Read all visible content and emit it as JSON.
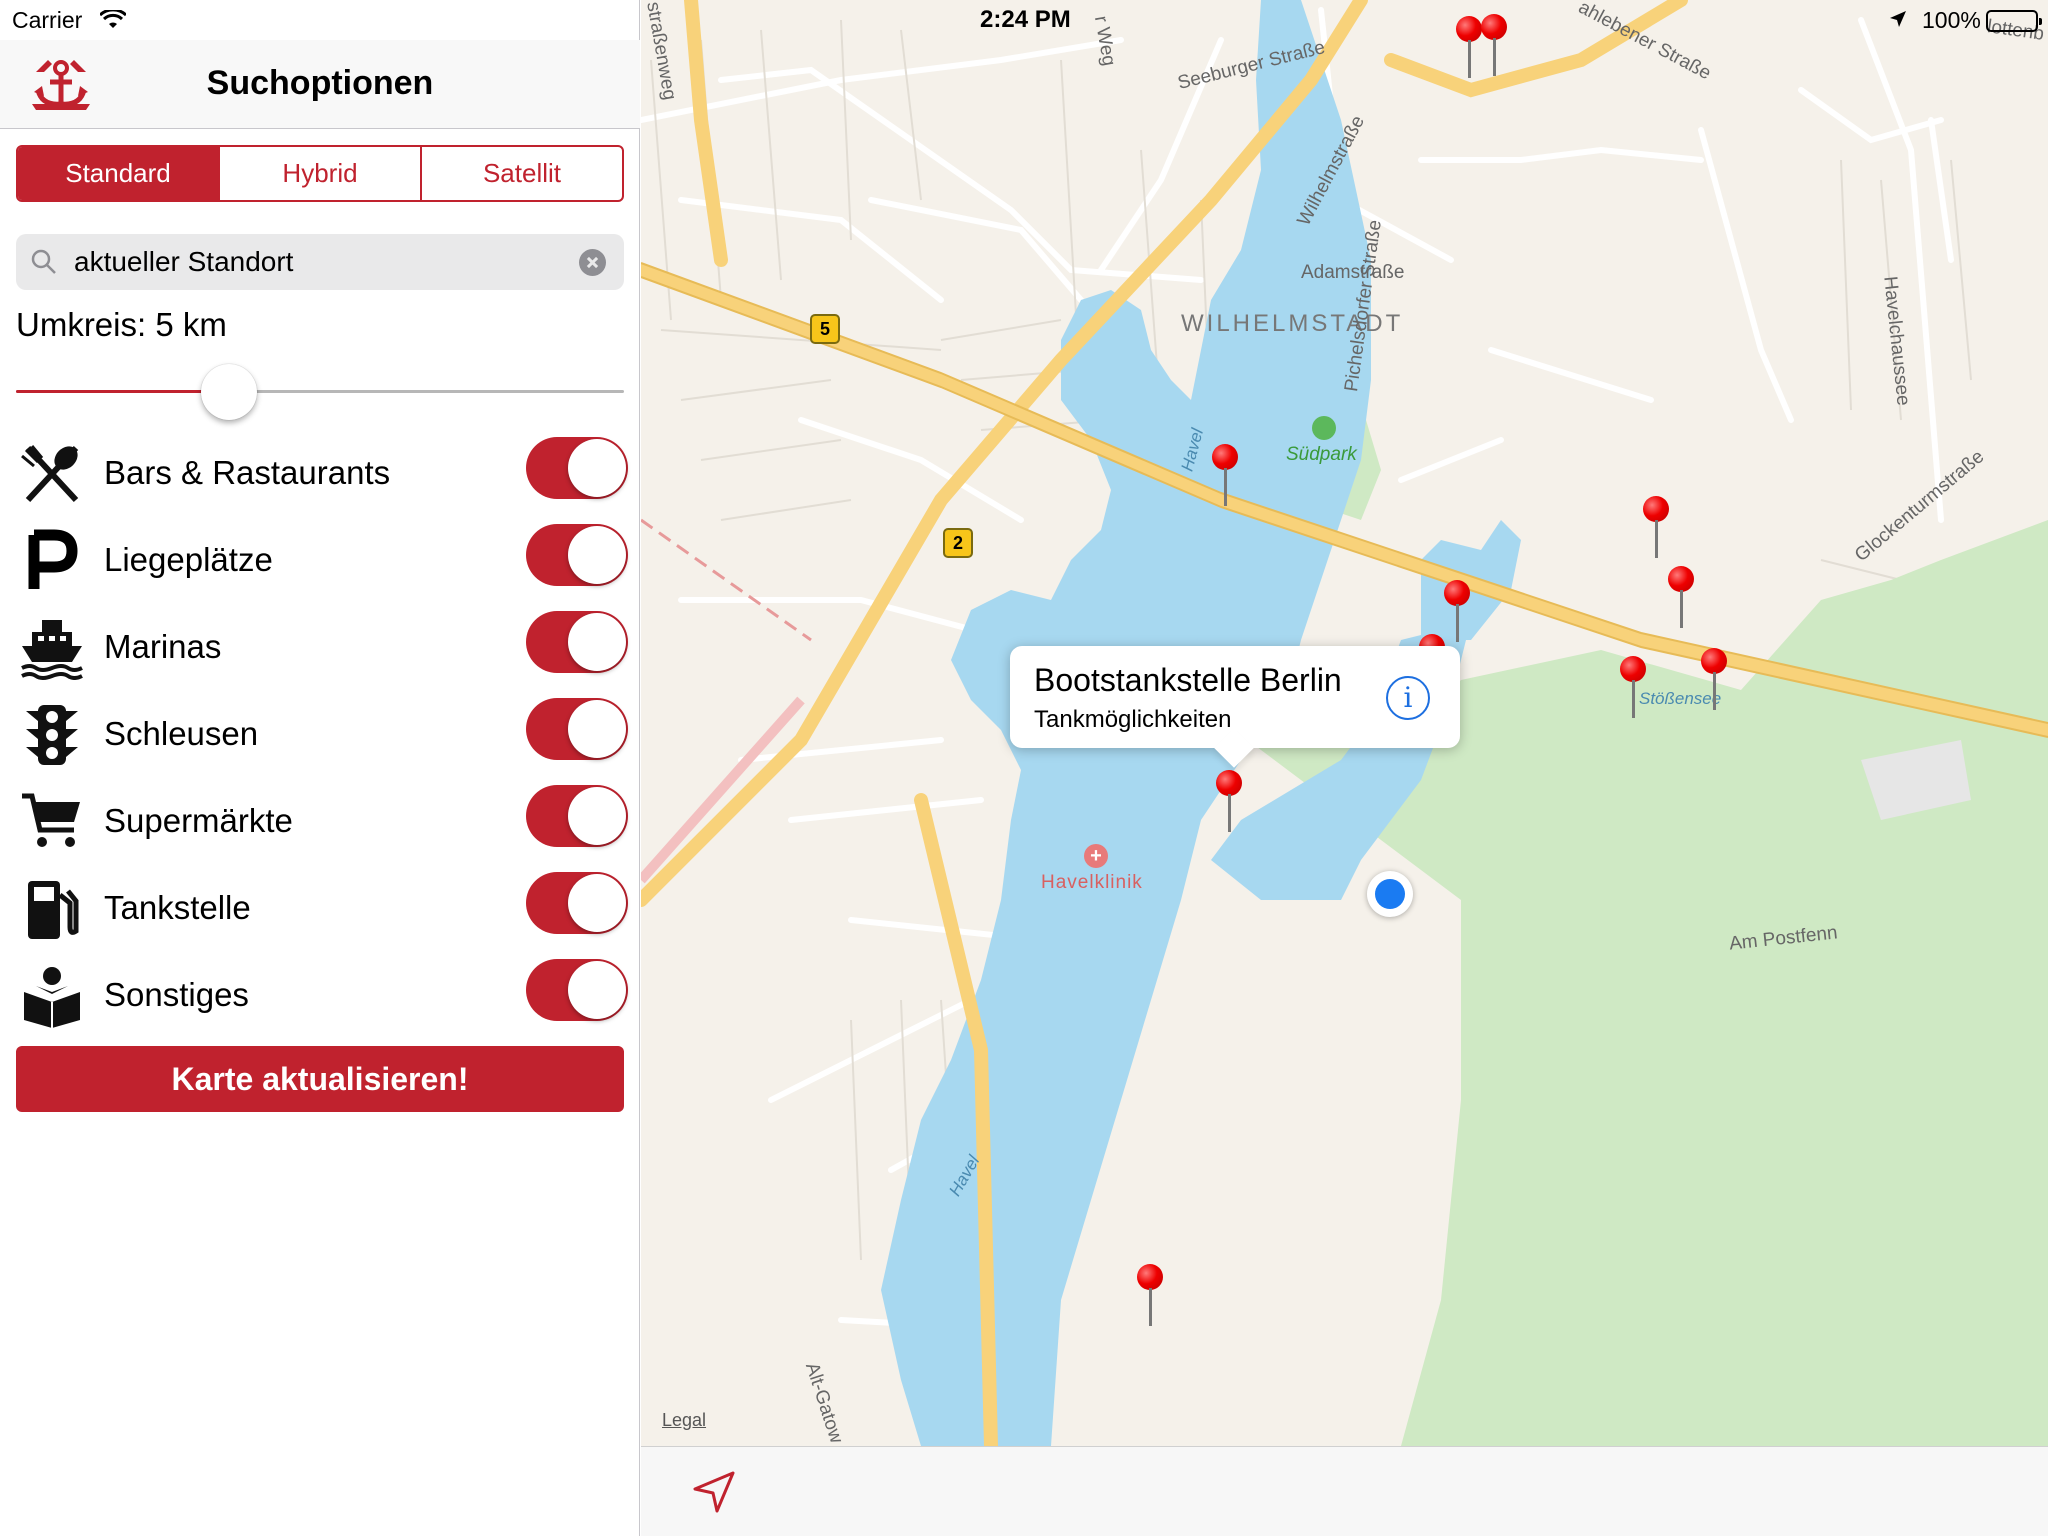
{
  "status_bar": {
    "carrier": "Carrier",
    "time": "2:24 PM",
    "battery": "100%"
  },
  "sidebar": {
    "title": "Suchoptionen",
    "segments": [
      "Standard",
      "Hybrid",
      "Satellit"
    ],
    "selected_segment": "Standard",
    "search_value": "aktueller Standort",
    "radius_label": "Umkreis: 5 km",
    "radius_slider_fraction": 0.35,
    "filters": [
      {
        "label": "Bars & Rastaurants",
        "icon": "fork-spoon-icon",
        "enabled": true
      },
      {
        "label": "Liegeplätze",
        "icon": "parking-icon",
        "enabled": true
      },
      {
        "label": "Marinas",
        "icon": "boat-icon",
        "enabled": true
      },
      {
        "label": "Schleusen",
        "icon": "traffic-light-icon",
        "enabled": true
      },
      {
        "label": "Supermärkte",
        "icon": "shopping-cart-icon",
        "enabled": true
      },
      {
        "label": "Tankstelle",
        "icon": "fuel-pump-icon",
        "enabled": true
      },
      {
        "label": "Sonstiges",
        "icon": "reading-person-icon",
        "enabled": true
      }
    ],
    "refresh_button": "Karte aktualisieren!",
    "accent": "#c0222e"
  },
  "map": {
    "callout_title": "Bootstankstelle Berlin",
    "callout_subtitle": "Tankmöglichkeiten",
    "legal": "Legal",
    "labels": {
      "wilhelmstadt": "WILHELMSTADT",
      "adamstrasse": "Adamstraße",
      "seeburger": "Seeburger Straße",
      "wilhelmstrasse": "Wilhelmstraße",
      "pichelsdorfer": "Pichelsdorfer Straße",
      "suedpark": "Südpark",
      "havelklinik": "Havelklinik",
      "stoessensee": "Stößensee",
      "am_postfenn": "Am Postfenn",
      "havelchaussee": "Havelchaussee",
      "glockenturm": "Glockenturmstraße",
      "havel1": "Havel",
      "havel2": "Havel",
      "alt_gatow": "Alt-Gatow",
      "strasse_top": "straßenweg",
      "weg_top": "r Weg",
      "dahlebener": "ahlebener Straße",
      "charlotten": "lottenb"
    },
    "road_shields": [
      "5",
      "2"
    ],
    "colors": {
      "water": "#a7d8f0",
      "park": "#cfe9c4",
      "land": "#f5f1ea",
      "major_road": "#f8d27a"
    }
  }
}
